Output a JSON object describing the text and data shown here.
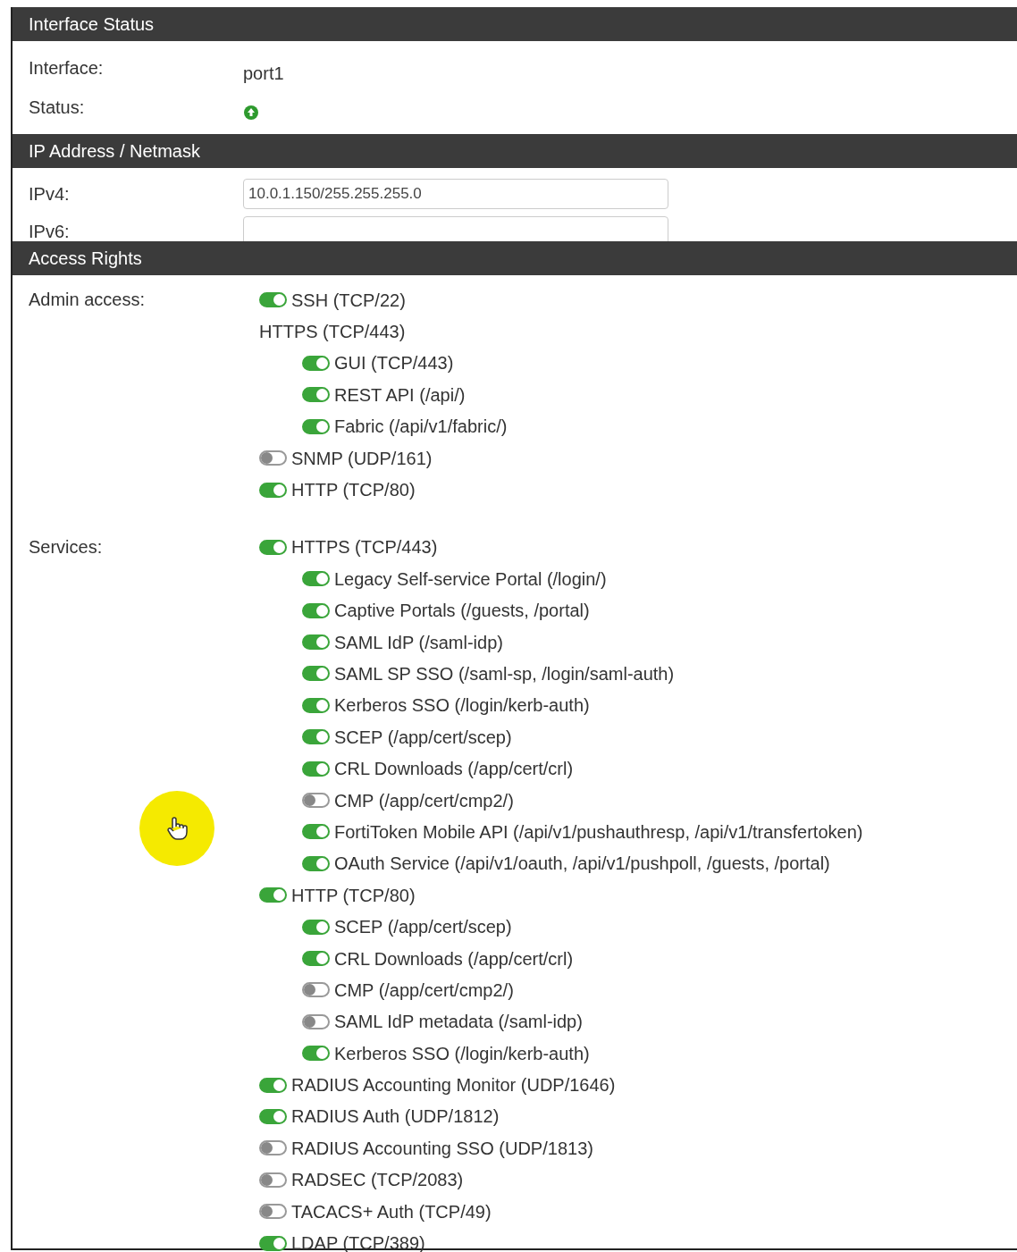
{
  "interface_status": {
    "title": "Interface Status",
    "fields": [
      {
        "label": "Interface:",
        "kind": "text",
        "value": "port1"
      },
      {
        "label": "Status:",
        "kind": "status",
        "up": true
      }
    ]
  },
  "ip_address": {
    "title": "IP Address / Netmask",
    "fields": [
      {
        "label": "IPv4:",
        "value": "10.0.1.150/255.255.255.0"
      },
      {
        "label": "IPv6:"
      }
    ]
  },
  "access_rights": {
    "title": "Access Rights",
    "groups": [
      {
        "label": "Admin access:",
        "items": [
          {
            "kind": "toggle",
            "label": "SSH (TCP/22)",
            "on": true
          },
          {
            "kind": "heading",
            "label": "HTTPS (TCP/443)",
            "children": [
              {
                "kind": "toggle",
                "label": "GUI (TCP/443)",
                "on": true
              },
              {
                "kind": "toggle",
                "label": "REST API (/api/)",
                "on": true
              },
              {
                "kind": "toggle",
                "label": "Fabric (/api/v1/fabric/)",
                "on": true
              }
            ]
          },
          {
            "kind": "toggle",
            "label": "SNMP (UDP/161)",
            "on": false
          },
          {
            "kind": "toggle",
            "label": "HTTP (TCP/80)",
            "on": true
          }
        ]
      },
      {
        "label": "Services:",
        "items": [
          {
            "kind": "toggle",
            "label": "HTTPS (TCP/443)",
            "on": true,
            "children": [
              {
                "kind": "toggle",
                "label": "Legacy Self-service Portal (/login/)",
                "on": true
              },
              {
                "kind": "toggle",
                "label": "Captive Portals (/guests, /portal)",
                "on": true
              },
              {
                "kind": "toggle",
                "label": "SAML IdP (/saml-idp)",
                "on": true
              },
              {
                "kind": "toggle",
                "label": "SAML SP SSO (/saml-sp, /login/saml-auth)",
                "on": true
              },
              {
                "kind": "toggle",
                "label": "Kerberos SSO (/login/kerb-auth)",
                "on": true
              },
              {
                "kind": "toggle",
                "label": "SCEP (/app/cert/scep)",
                "on": true
              },
              {
                "kind": "toggle",
                "label": "CRL Downloads (/app/cert/crl)",
                "on": true
              },
              {
                "kind": "toggle",
                "label": "CMP (/app/cert/cmp2/)",
                "on": false
              },
              {
                "kind": "toggle",
                "label": "FortiToken Mobile API (/api/v1/pushauthresp, /api/v1/transfertoken)",
                "on": true
              },
              {
                "kind": "toggle",
                "label": "OAuth Service (/api/v1/oauth, /api/v1/pushpoll, /guests, /portal)",
                "on": true
              }
            ]
          },
          {
            "kind": "toggle",
            "label": "HTTP (TCP/80)",
            "on": true,
            "children": [
              {
                "kind": "toggle",
                "label": "SCEP (/app/cert/scep)",
                "on": true
              },
              {
                "kind": "toggle",
                "label": "CRL Downloads (/app/cert/crl)",
                "on": true
              },
              {
                "kind": "toggle",
                "label": "CMP (/app/cert/cmp2/)",
                "on": false
              },
              {
                "kind": "toggle",
                "label": "SAML IdP metadata (/saml-idp)",
                "on": false
              },
              {
                "kind": "toggle",
                "label": "Kerberos SSO (/login/kerb-auth)",
                "on": true
              }
            ]
          },
          {
            "kind": "toggle",
            "label": "RADIUS Accounting Monitor (UDP/1646)",
            "on": true
          },
          {
            "kind": "toggle",
            "label": "RADIUS Auth (UDP/1812)",
            "on": true
          },
          {
            "kind": "toggle",
            "label": "RADIUS Accounting SSO (UDP/1813)",
            "on": false
          },
          {
            "kind": "toggle",
            "label": "RADSEC (TCP/2083)",
            "on": false
          },
          {
            "kind": "toggle",
            "label": "TACACS+ Auth (TCP/49)",
            "on": false
          },
          {
            "kind": "toggle",
            "label": "LDAP (TCP/389)",
            "on": true
          }
        ]
      }
    ]
  }
}
